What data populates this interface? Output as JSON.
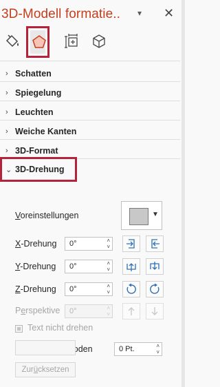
{
  "pane": {
    "title": "3D-Modell formatie..",
    "dropdown_glyph": "▾",
    "close_glyph": "✕"
  },
  "tabs": [
    {
      "name": "fill-line",
      "icon": "paint-bucket-icon"
    },
    {
      "name": "effects",
      "icon": "pentagon-icon",
      "active": true
    },
    {
      "name": "size-properties",
      "icon": "size-properties-icon"
    },
    {
      "name": "3d-model",
      "icon": "cube-icon"
    }
  ],
  "sections": {
    "shadow": "Schatten",
    "reflection": "Spiegelung",
    "glow": "Leuchten",
    "soft_edges": "Weiche Kanten",
    "format_3d": "3D-Format",
    "rotation_3d": "3D-Drehung"
  },
  "rotation": {
    "presets_label_u": "V",
    "presets_label_rest": "oreinstellungen",
    "x_label_u": "X",
    "x_label_rest": "-Drehung",
    "x_value": "0°",
    "y_label_u": "Y",
    "y_label_rest": "-Drehung",
    "y_value": "0°",
    "z_label_u": "Z",
    "z_label_rest": "-Drehung",
    "z_value": "0°",
    "perspective_label_pre": "P",
    "perspective_label_u": "e",
    "perspective_label_rest": "rspektive",
    "perspective_value": "0°",
    "keep_text_flat": "Text nicht drehen",
    "distance_label_u": "A",
    "distance_label_rest": "bstand vom Boden",
    "distance_value": "0 Pt.",
    "reset_pre": "Zur",
    "reset_u": "ü",
    "reset_rest": "cksetzen"
  },
  "colors": {
    "title": "#c43e1c",
    "highlight": "#b5233a",
    "icon_blue": "#2f6fb3"
  }
}
